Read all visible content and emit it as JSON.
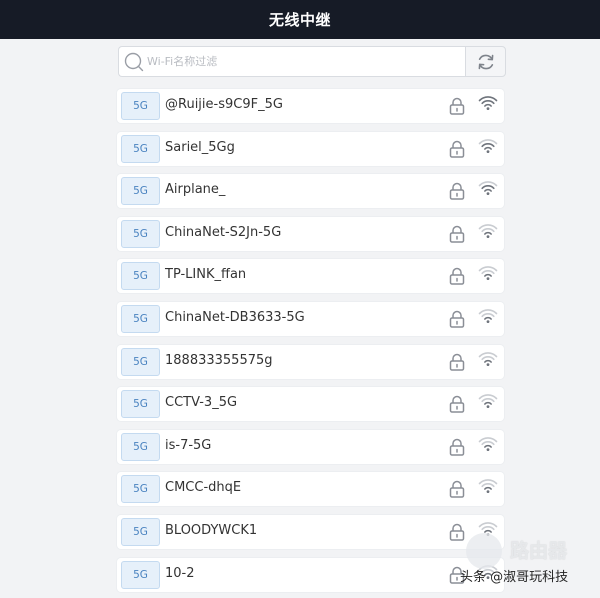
{
  "header": {
    "title": "无线中继"
  },
  "search": {
    "placeholder": "Wi-Fi名称过滤",
    "value": ""
  },
  "icons": {
    "search": "search-icon",
    "refresh": "refresh-icon",
    "lock": "lock-icon",
    "wifi": "wifi-signal-icon"
  },
  "colors": {
    "header_bg": "#161b26",
    "badge_bg": "#e6f0fa",
    "badge_text": "#4a83c0"
  },
  "networks": [
    {
      "band": "5G",
      "ssid": "@Ruijie-s9C9F_5G",
      "signal": 4
    },
    {
      "band": "5G",
      "ssid": "Sariel_5Gg",
      "signal": 3
    },
    {
      "band": "5G",
      "ssid": "Airplane_",
      "signal": 3
    },
    {
      "band": "5G",
      "ssid": "ChinaNet-S2Jn-5G",
      "signal": 2
    },
    {
      "band": "5G",
      "ssid": "TP-LINK_ffan",
      "signal": 2
    },
    {
      "band": "5G",
      "ssid": "ChinaNet-DB3633-5G",
      "signal": 2
    },
    {
      "band": "5G",
      "ssid": "188833355575g",
      "signal": 2
    },
    {
      "band": "5G",
      "ssid": "CCTV-3_5G",
      "signal": 2
    },
    {
      "band": "5G",
      "ssid": "is-7-5G",
      "signal": 2
    },
    {
      "band": "5G",
      "ssid": "CMCC-dhqE",
      "signal": 2
    },
    {
      "band": "5G",
      "ssid": "BLOODYWCK1",
      "signal": 2
    },
    {
      "band": "5G",
      "ssid": "10-2",
      "signal": 2
    }
  ],
  "watermark": {
    "brand": "路由器",
    "credit": "头条 @淑哥玩科技"
  }
}
